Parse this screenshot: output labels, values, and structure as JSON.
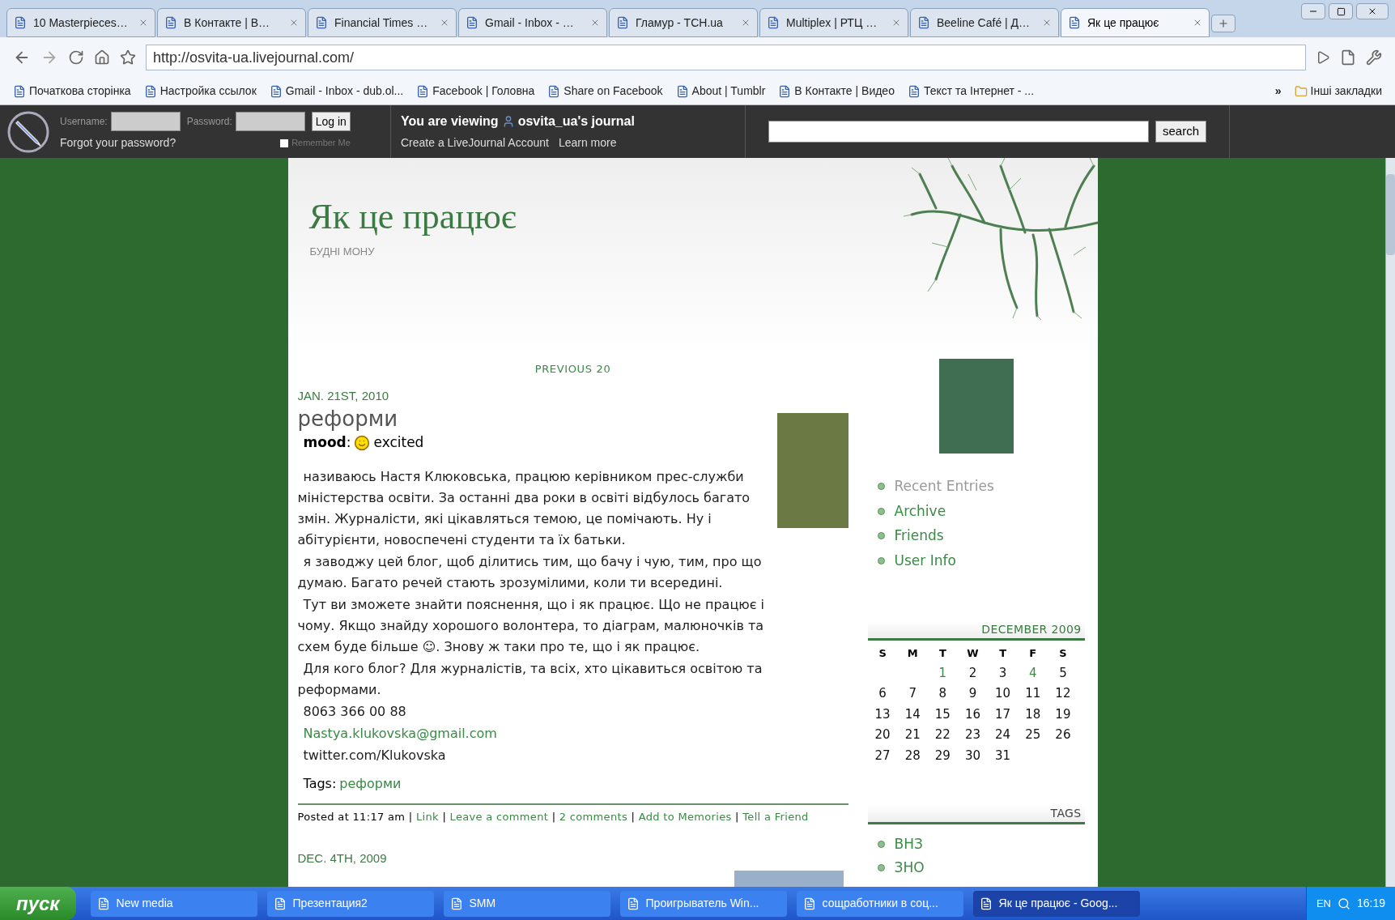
{
  "browser": {
    "tabs": [
      {
        "title": "10 Masterpieces…",
        "selected": false
      },
      {
        "title": "В Контакте | В…",
        "selected": false
      },
      {
        "title": "Financial Times …",
        "selected": false
      },
      {
        "title": "Gmail - Inbox - …",
        "selected": false
      },
      {
        "title": "Гламур - ТСН.ua",
        "selected": false
      },
      {
        "title": "Multiplex | РТЦ …",
        "selected": false
      },
      {
        "title": "Beeline Café | Д…",
        "selected": false
      },
      {
        "title": "Як це працює",
        "selected": true
      }
    ],
    "address": "http://osvita-ua.livejournal.com/",
    "bookmarks": [
      "Початкова сторінка",
      "Настройка ссылок",
      "Gmail - Inbox - dub.ol...",
      "Facebook | Головна",
      "Share on Facebook",
      "About | Tumblr",
      "В Контакте | Видео",
      "Текст та Інтернет - ..."
    ],
    "more_bookmarks": "»",
    "other_bookmarks": "Інші закладки"
  },
  "lj_bar": {
    "username_label": "Username:",
    "password_label": "Password:",
    "login_button": "Log in",
    "remember": {
      "label": "Remember Me",
      "checked": false
    },
    "forgot": "Forgot your password?",
    "viewing_prefix": "You are viewing",
    "journal": "osvita_ua's journal",
    "create_account": "Create a LiveJournal Account",
    "learn_more": "Learn more",
    "search_button": "search"
  },
  "journal": {
    "title": "Як це працює",
    "subtitle": "БУДНІ МОНУ",
    "previous": "PREVIOUS 20",
    "posts": [
      {
        "date": "JAN. 21ST, 2010",
        "title": "реформи",
        "mood_label": "**mood**:",
        "mood": "excited",
        "paragraphs": [
          "називаюсь Настя Клюковська, працюю керівником прес-служби міністерства освіти. За останні два роки в освіті відбулось багато змін. Журналісти, які цікавляться темою, це помічають. Ну і абітурієнти, новоспечені студенти та їх батьки.",
          "я заводжу цей блог, щоб ділитись тим, що бачу і чую, тим, про що думаю. Багато речей стають зрозумілими, коли ти всередині.",
          "Тут ви зможете знайти пояснення, що і як працює. Що не працює і чому. Якщо знайду хорошого волонтера, то діаграм, малюночків та схем буде більше ☺. Знову ж таки про те, що і як працює.",
          "Для кого блог? Для журналістів, та всіх, хто цікавиться освітою та реформами."
        ],
        "phone": "8063 366 00 88",
        "email": "Nastya.klukovska@gmail.com",
        "twitter": "twitter.com/Klukovska",
        "tags_label": "Tags:",
        "tags": [
          "реформи"
        ],
        "posted": "Posted at 11:17 am",
        "separator": "|",
        "actions": [
          "Link",
          "Leave a comment",
          "2 comments",
          "Add to Memories",
          "Tell a Friend"
        ]
      },
      {
        "date": "DEC. 4TH, 2009"
      }
    ]
  },
  "sidebar": {
    "nav": [
      {
        "label": "Recent Entries",
        "selected": true
      },
      {
        "label": "Archive",
        "selected": false
      },
      {
        "label": "Friends",
        "selected": false
      },
      {
        "label": "User Info",
        "selected": false
      }
    ],
    "calendar": {
      "title": "DECEMBER 2009",
      "weekdays": [
        "S",
        "M",
        "T",
        "W",
        "T",
        "F",
        "S"
      ],
      "weeks": [
        [
          {
            "kind": "blank"
          },
          {
            "kind": "blank"
          },
          {
            "kind": "day",
            "day": "1",
            "link": true
          },
          {
            "kind": "day",
            "day": "2",
            "link": false
          },
          {
            "kind": "day",
            "day": "3",
            "link": false
          },
          {
            "kind": "day",
            "day": "4",
            "link": true
          },
          {
            "kind": "day",
            "day": "5",
            "link": false
          }
        ],
        [
          {
            "kind": "day",
            "day": "6",
            "link": false
          },
          {
            "kind": "day",
            "day": "7",
            "link": false
          },
          {
            "kind": "day",
            "day": "8",
            "link": false
          },
          {
            "kind": "day",
            "day": "9",
            "link": false
          },
          {
            "kind": "day",
            "day": "10",
            "link": false
          },
          {
            "kind": "day",
            "day": "11",
            "link": false
          },
          {
            "kind": "day",
            "day": "12",
            "link": false
          }
        ],
        [
          {
            "kind": "day",
            "day": "13",
            "link": false
          },
          {
            "kind": "day",
            "day": "14",
            "link": false
          },
          {
            "kind": "day",
            "day": "15",
            "link": false
          },
          {
            "kind": "day",
            "day": "16",
            "link": false
          },
          {
            "kind": "day",
            "day": "17",
            "link": false
          },
          {
            "kind": "day",
            "day": "18",
            "link": false
          },
          {
            "kind": "day",
            "day": "19",
            "link": false
          }
        ],
        [
          {
            "kind": "day",
            "day": "20",
            "link": false
          },
          {
            "kind": "day",
            "day": "21",
            "link": false
          },
          {
            "kind": "day",
            "day": "22",
            "link": false
          },
          {
            "kind": "day",
            "day": "23",
            "link": false
          },
          {
            "kind": "day",
            "day": "24",
            "link": false
          },
          {
            "kind": "day",
            "day": "25",
            "link": false
          },
          {
            "kind": "day",
            "day": "26",
            "link": false
          }
        ],
        [
          {
            "kind": "day",
            "day": "27",
            "link": false
          },
          {
            "kind": "day",
            "day": "28",
            "link": false
          },
          {
            "kind": "day",
            "day": "29",
            "link": false
          },
          {
            "kind": "day",
            "day": "30",
            "link": false
          },
          {
            "kind": "day",
            "day": "31",
            "link": false
          },
          {
            "kind": "blank"
          },
          {
            "kind": "blank"
          }
        ]
      ]
    },
    "tags_title": "TAGS",
    "tags": [
      "ВНЗ",
      "ЗНО"
    ]
  },
  "taskbar": {
    "start": "пуск",
    "items": [
      {
        "label": "New media",
        "selected": false
      },
      {
        "label": "Презентация2",
        "selected": false
      },
      {
        "label": "SMM",
        "selected": false
      },
      {
        "label": "Проигрыватель Win...",
        "selected": false
      },
      {
        "label": "сощработники в соц...",
        "selected": false
      },
      {
        "label": "Як це працює - Goog...",
        "selected": true
      }
    ],
    "language": "EN",
    "clock": "16:19"
  }
}
